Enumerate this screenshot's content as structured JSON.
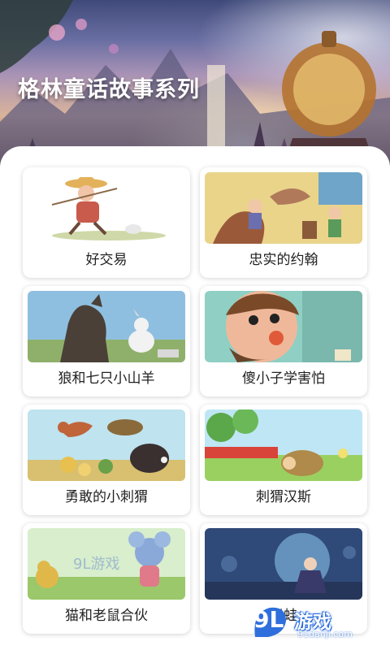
{
  "header": {
    "title": "格林童话故事系列"
  },
  "stories": [
    {
      "title": "好交易"
    },
    {
      "title": "忠实的约翰"
    },
    {
      "title": "狼和七只小山羊"
    },
    {
      "title": "傻小子学害怕"
    },
    {
      "title": "勇敢的小刺猬"
    },
    {
      "title": "刺猬汉斯"
    },
    {
      "title": "猫和老鼠合伙"
    },
    {
      "title": "青蛙"
    }
  ],
  "watermark": {
    "logo": "9L",
    "name": "游戏",
    "domain": "91danji.com"
  },
  "colors": {
    "panel": "#ffffff",
    "card_shadow": "rgba(0,0,0,0.18)",
    "title_text": "#ffffff",
    "label_text": "#222222",
    "watermark_accent": "#2e6fdc"
  }
}
